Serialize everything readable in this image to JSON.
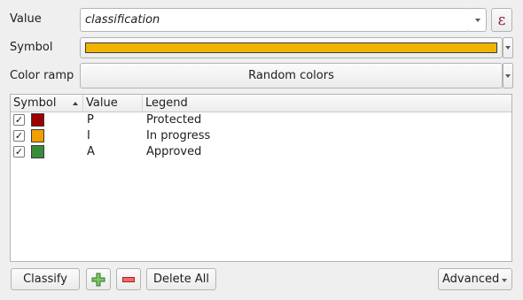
{
  "value": {
    "label": "Value",
    "field": "classification",
    "expression_icon": "ε"
  },
  "symbol": {
    "label": "Symbol",
    "color": "#f0b400"
  },
  "color_ramp": {
    "label": "Color ramp",
    "value": "Random colors"
  },
  "table": {
    "headers": {
      "symbol": "Symbol",
      "value": "Value",
      "legend": "Legend"
    },
    "rows": [
      {
        "checked": true,
        "color": "#9b0000",
        "value": "P",
        "legend": "Protected"
      },
      {
        "checked": true,
        "color": "#f0a000",
        "value": "I",
        "legend": "In progress"
      },
      {
        "checked": true,
        "color": "#3a8c3a",
        "value": "A",
        "legend": "Approved"
      }
    ]
  },
  "buttons": {
    "classify": "Classify",
    "delete_all": "Delete All",
    "advanced": "Advanced",
    "add_icon": "plus-icon",
    "remove_icon": "minus-icon"
  }
}
